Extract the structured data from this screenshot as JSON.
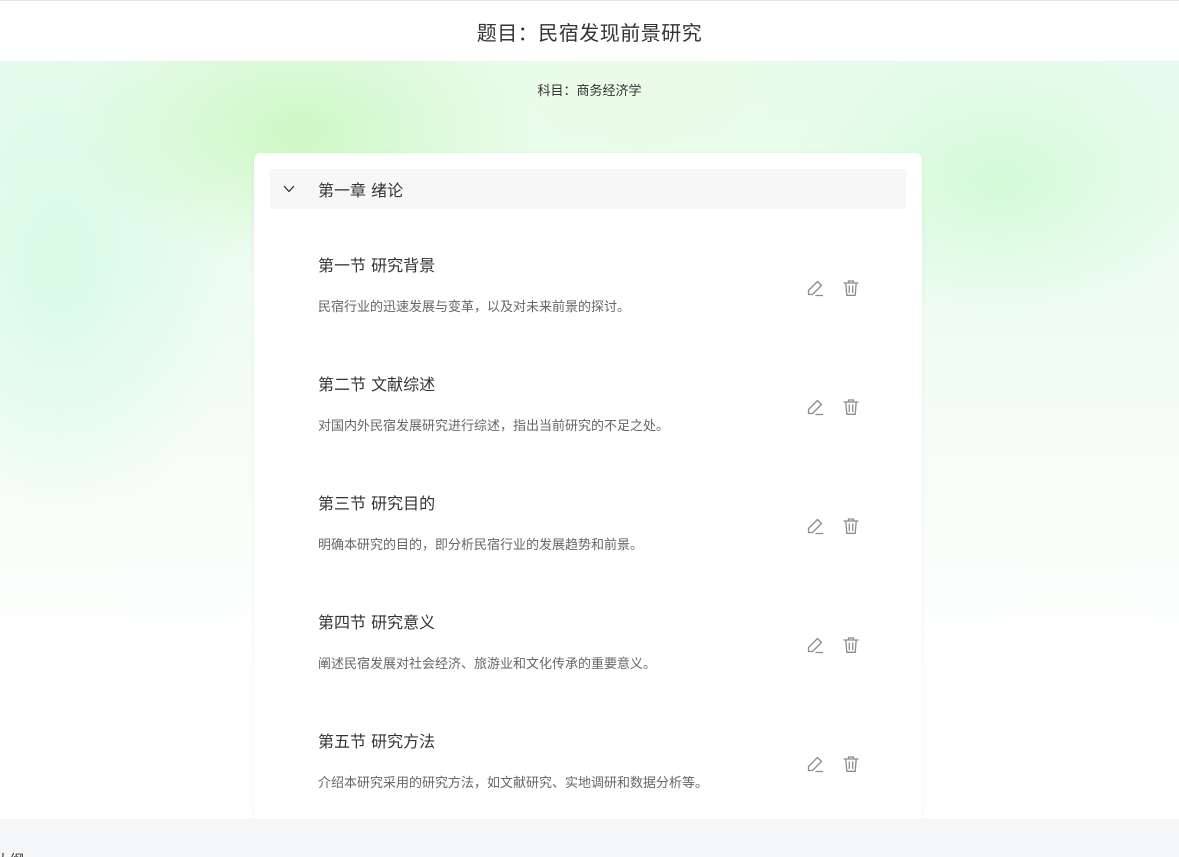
{
  "header": {
    "title": "题目：民宿发现前景研究"
  },
  "subject": {
    "text": "科目：商务经济学"
  },
  "chapter": {
    "title": "第一章 绪论",
    "expanded": true,
    "icon": "chevron-down-icon"
  },
  "sections": [
    {
      "title": "第一节 研究背景",
      "description": "民宿行业的迅速发展与变革，以及对未来前景的探讨。"
    },
    {
      "title": "第二节 文献综述",
      "description": "对国内外民宿发展研究进行综述，指出当前研究的不足之处。"
    },
    {
      "title": "第三节 研究目的",
      "description": "明确本研究的目的，即分析民宿行业的发展趋势和前景。"
    },
    {
      "title": "第四节 研究意义",
      "description": "阐述民宿发展对社会经济、旅游业和文化传承的重要意义。"
    },
    {
      "title": "第五节 研究方法",
      "description": "介绍本研究采用的研究方法，如文献研究、实地调研和数据分析等。"
    }
  ],
  "actions": {
    "edit_icon": "pencil-icon",
    "delete_icon": "trash-icon"
  },
  "footer": {
    "fragment": "大纲"
  },
  "colors": {
    "icon": "#8c8c8c",
    "card_bg": "#ffffff",
    "chapter_bg": "#f7f7f7",
    "footer_bg": "#f5f6f8"
  }
}
